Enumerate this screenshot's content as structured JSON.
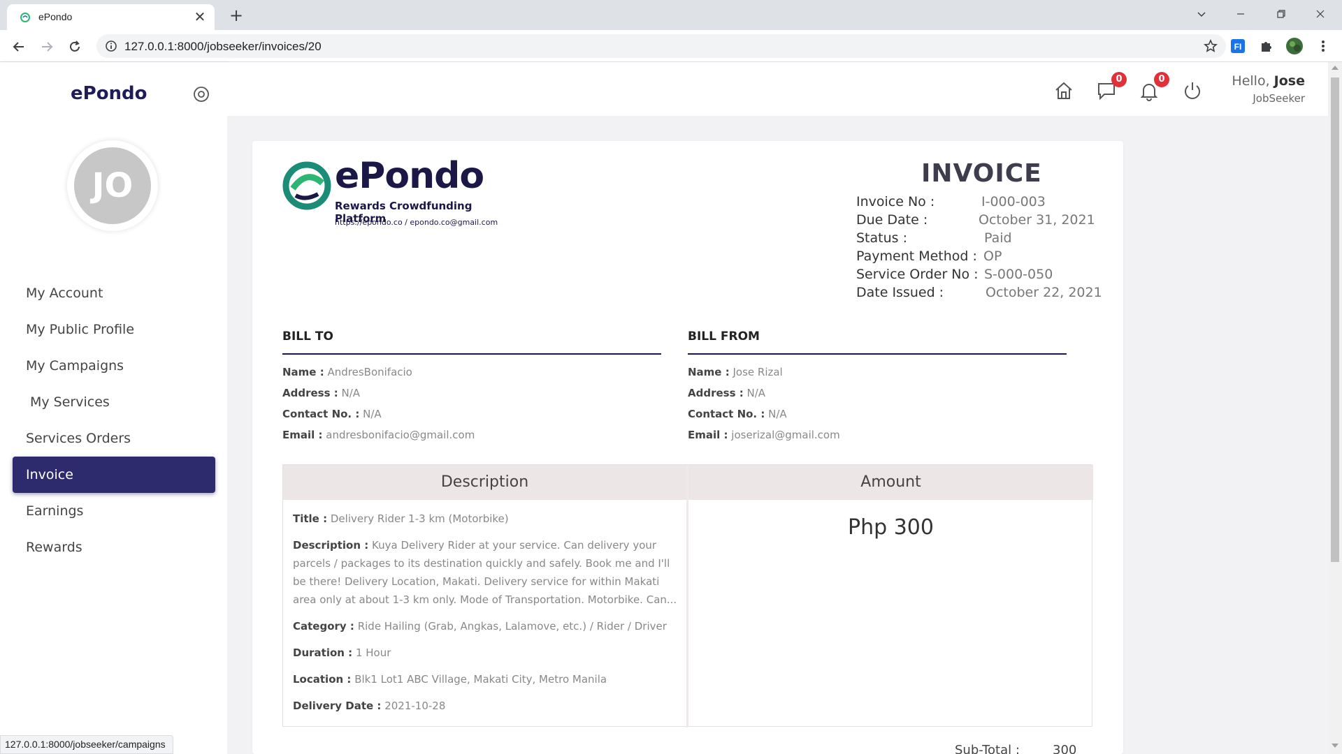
{
  "browser": {
    "tab_title": "ePondo",
    "url": "127.0.0.1:8000/jobseeker/invoices/20",
    "status_url": "127.0.0.1:8000/jobseeker/campaigns"
  },
  "sidebar": {
    "brand": "ePondo",
    "avatar_initials": "JO",
    "items": [
      {
        "label": "My Account"
      },
      {
        "label": "My Public Profile"
      },
      {
        "label": "My Campaigns"
      },
      {
        "label": "My Services"
      },
      {
        "label": "Services Orders"
      },
      {
        "label": "Invoice",
        "active": true
      },
      {
        "label": "Earnings"
      },
      {
        "label": "Rewards"
      }
    ]
  },
  "header": {
    "messages_count": "0",
    "notifications_count": "0",
    "greeting": "Hello,",
    "user_name": "Jose",
    "role": "JobSeeker"
  },
  "logo": {
    "wordmark": "ePondo",
    "tagline": "Rewards Crowdfunding Platform",
    "contact": "https://epondo.co / epondo.co@gmail.com"
  },
  "invoice": {
    "title": "INVOICE",
    "meta": [
      {
        "label": "Invoice No :",
        "value": "I-000-003"
      },
      {
        "label": "Due Date :",
        "value": "October 31, 2021"
      },
      {
        "label": "Status :",
        "value": "Paid"
      },
      {
        "label": "Payment Method :",
        "value": "OP"
      },
      {
        "label": "Service Order No :",
        "value": "S-000-050"
      },
      {
        "label": "Date Issued :",
        "value": "October 22, 2021"
      }
    ]
  },
  "bill_to": {
    "heading": "BILL TO",
    "rows": [
      {
        "label": "Name :",
        "value": "AndresBonifacio"
      },
      {
        "label": "Address :",
        "value": "N/A"
      },
      {
        "label": "Contact No. :",
        "value": "N/A"
      },
      {
        "label": "Email :",
        "value": "andresbonifacio@gmail.com"
      }
    ]
  },
  "bill_from": {
    "heading": "BILL FROM",
    "rows": [
      {
        "label": "Name :",
        "value": "Jose Rizal"
      },
      {
        "label": "Address :",
        "value": "N/A"
      },
      {
        "label": "Contact No. :",
        "value": "N/A"
      },
      {
        "label": "Email :",
        "value": "joserizal@gmail.com"
      }
    ]
  },
  "table": {
    "headers": [
      "Description",
      "Amount"
    ],
    "rows": [
      {
        "label": "Title :",
        "value": "Delivery Rider 1-3 km (Motorbike)"
      },
      {
        "label": "Description :",
        "value": "Kuya Delivery Rider at your service. Can delivery your parcels / packages to its destination quickly and safely. Book me and I'll be there! Delivery Location, Makati. Delivery service for within Makati area only at about 1-3 km only. Mode of Transportation. Motorbike. Can..."
      },
      {
        "label": "Category :",
        "value": "Ride Hailing (Grab, Angkas, Lalamove, etc.) / Rider / Driver"
      },
      {
        "label": "Duration :",
        "value": "1 Hour"
      },
      {
        "label": "Location :",
        "value": "Blk1 Lot1 ABC Village, Makati City, Metro Manila"
      },
      {
        "label": "Delivery Date :",
        "value": "2021-10-28"
      }
    ],
    "amount": "Php 300"
  },
  "subtotal": {
    "label": "Sub-Total :",
    "value": "300"
  }
}
